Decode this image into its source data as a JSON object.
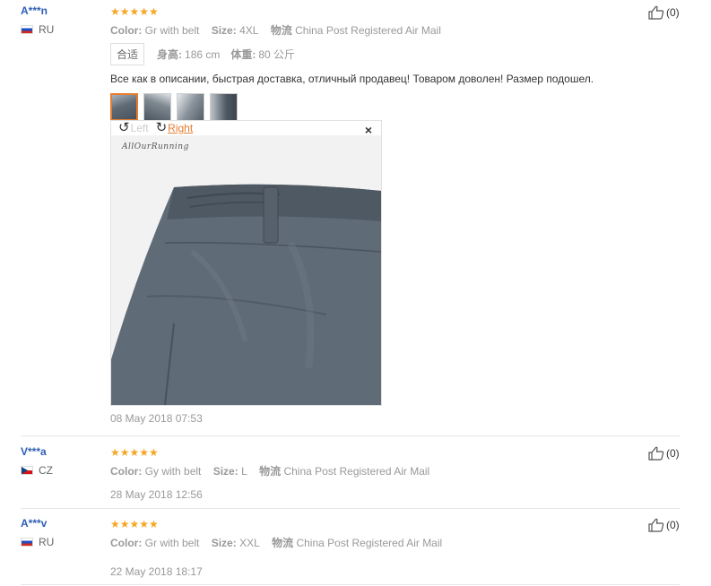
{
  "reviews": [
    {
      "name": "A***n",
      "country": "RU",
      "stars": "★★★★★",
      "color_label": "Color:",
      "color_value": "Gr with belt",
      "size_label": "Size:",
      "size_value": "4XL",
      "ship_label": "物流",
      "ship_value": "China Post Registered Air Mail",
      "fit_tag": "合适",
      "height_label": "身高:",
      "height_value": "186 cm",
      "weight_label": "体重:",
      "weight_value": "80 公斤",
      "text": "Все как в описании, быстрая доставка, отличный продавец! Товаром доволен! Размер подошел.",
      "viewer": {
        "left": "Left",
        "right": "Right",
        "close": "×",
        "watermark": "AllOurRunning"
      },
      "date": "08 May 2018 07:53",
      "likes": "(0)"
    },
    {
      "name": "V***a",
      "country": "CZ",
      "stars": "★★★★★",
      "color_label": "Color:",
      "color_value": "Gy with belt",
      "size_label": "Size:",
      "size_value": "L",
      "ship_label": "物流",
      "ship_value": "China Post Registered Air Mail",
      "date": "28 May 2018 12:56",
      "likes": "(0)"
    },
    {
      "name": "A***v",
      "country": "RU",
      "stars": "★★★★★",
      "color_label": "Color:",
      "color_value": "Gr with belt",
      "size_label": "Size:",
      "size_value": "XXL",
      "ship_label": "物流",
      "ship_value": "China Post Registered Air Mail",
      "date": "22 May 2018 18:17",
      "likes": "(0)"
    }
  ]
}
